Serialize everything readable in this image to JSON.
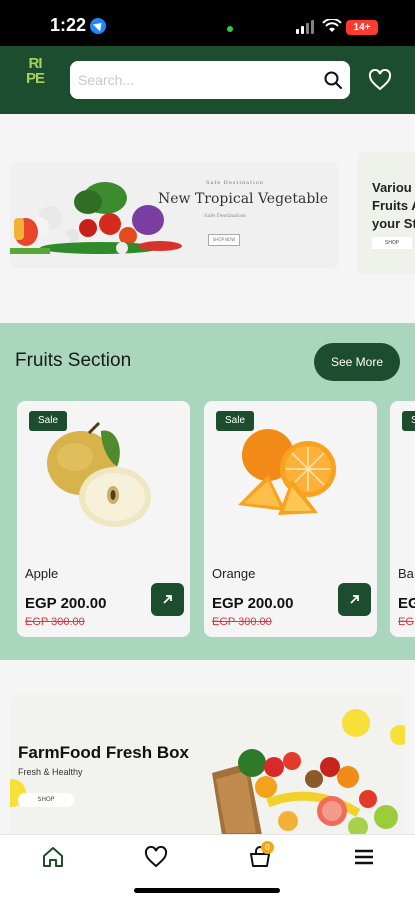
{
  "status_bar": {
    "time": "1:22",
    "battery": "14+"
  },
  "header": {
    "logo_letters": [
      "RI",
      "PE"
    ],
    "search": {
      "placeholder": "Search...",
      "value": ""
    }
  },
  "banners": [
    {
      "kicker": "Safe Destination",
      "title": "New Tropical Vegetable",
      "subtitle": "Safe Destination",
      "button": "SHOP NOW"
    },
    {
      "title": "Various Fruits A your St",
      "title_lines": [
        "Variou",
        "Fruits A",
        "your St"
      ],
      "button": "SHOP"
    }
  ],
  "fruits_section": {
    "title": "Fruits Section",
    "see_more": "See More",
    "products": [
      {
        "badge": "Sale",
        "name": "Apple",
        "price": "EGP 200.00",
        "old_price": "EGP 300.00"
      },
      {
        "badge": "Sale",
        "name": "Orange",
        "price": "EGP 200.00",
        "old_price": "EGP 300.00"
      },
      {
        "badge": "Sale",
        "name": "Ba",
        "price": "EG",
        "old_price": "EG"
      }
    ]
  },
  "farm_box": {
    "title": "FarmFood Fresh Box",
    "subtitle": "Fresh & Healthy",
    "button": "SHOP"
  },
  "bottom_nav": {
    "items": [
      "home-icon",
      "heart-icon",
      "cart-icon",
      "menu-icon"
    ],
    "cart_count": "0"
  },
  "colors": {
    "brand": "#1b4d2e",
    "section_bg": "#a9d6bd",
    "logo": "#a8d05c",
    "strike": "#e0343f"
  }
}
